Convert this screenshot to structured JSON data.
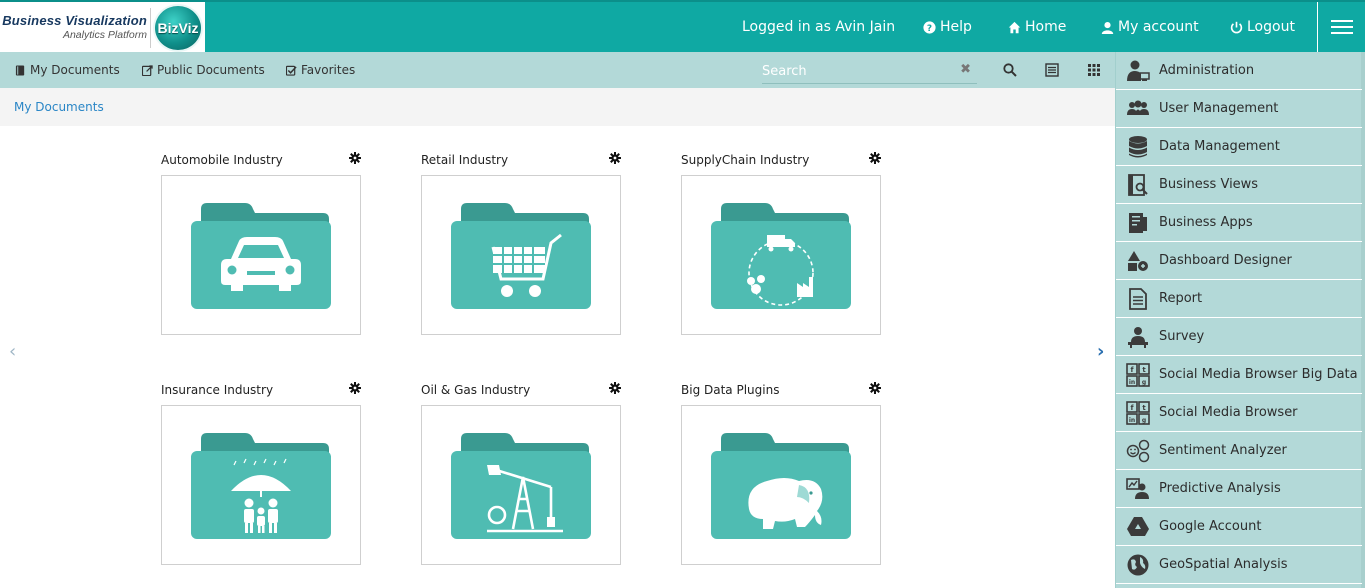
{
  "brand": {
    "title": "Business Visualization",
    "subtitle": "Analytics Platform",
    "badge": "BizViz"
  },
  "header": {
    "logged_in": "Logged in as Avin Jain",
    "help": "Help",
    "home": "Home",
    "account": "My account",
    "logout": "Logout"
  },
  "toolbar": {
    "my_documents": "My Documents",
    "public_documents": "Public Documents",
    "favorites": "Favorites",
    "search_placeholder": "Search",
    "clear_symbol": "✖"
  },
  "breadcrumb": {
    "current": "My Documents"
  },
  "folders": [
    {
      "title": "Automobile Industry",
      "icon": "car-icon"
    },
    {
      "title": "Retail Industry",
      "icon": "shopping-cart-icon"
    },
    {
      "title": "SupplyChain Industry",
      "icon": "supply-chain-icon"
    },
    {
      "title": "Insurance Industry",
      "icon": "umbrella-family-icon"
    },
    {
      "title": "Oil & Gas Industry",
      "icon": "oil-pump-icon"
    },
    {
      "title": "Big Data Plugins",
      "icon": "hadoop-elephant-icon"
    }
  ],
  "pager": {
    "prev": "‹",
    "next": "›"
  },
  "menu": {
    "items": [
      {
        "label": "Administration",
        "icon": "admin-user-icon"
      },
      {
        "label": "User Management",
        "icon": "users-icon"
      },
      {
        "label": "Data Management",
        "icon": "database-icon"
      },
      {
        "label": "Business Views",
        "icon": "business-view-icon"
      },
      {
        "label": "Business Apps",
        "icon": "business-apps-icon"
      },
      {
        "label": "Dashboard Designer",
        "icon": "dashboard-designer-icon"
      },
      {
        "label": "Report",
        "icon": "report-icon"
      },
      {
        "label": "Survey",
        "icon": "survey-icon"
      },
      {
        "label": "Social Media Browser Big Data",
        "icon": "social-grid-icon"
      },
      {
        "label": "Social Media Browser",
        "icon": "social-grid-icon"
      },
      {
        "label": "Sentiment Analyzer",
        "icon": "sentiment-icon"
      },
      {
        "label": "Predictive Analysis",
        "icon": "predictive-icon"
      },
      {
        "label": "Google Account",
        "icon": "google-drive-icon"
      },
      {
        "label": "GeoSpatial Analysis",
        "icon": "globe-icon"
      }
    ]
  },
  "colors": {
    "header": "#0fa9a3",
    "subbar": "#b3d9d8",
    "folder": "#4fbcb2",
    "folder_tab": "#3a9a91",
    "link": "#2a86c6"
  }
}
